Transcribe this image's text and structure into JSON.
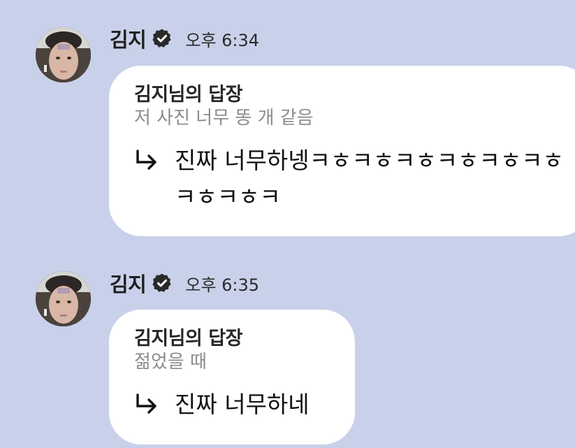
{
  "colors": {
    "background": "#c9d1ea",
    "bubble": "#ffffff",
    "verified_badge": "#2a2a2a",
    "quoted_text": "#8c8c8c"
  },
  "messages": [
    {
      "sender": "김지",
      "verified_icon": "verified-badge-icon",
      "time": "오후 6:34",
      "reply_label": "김지님의 답장",
      "quoted_text": "저 사진 너무 똥 개 같음",
      "reply_icon": "reply-arrow-icon",
      "body": "진짜 너무하넹ㅋㅎㅋㅎㅋㅎㅋㅎㅋㅎㅋㅎㅋㅎㅋㅎㅋ"
    },
    {
      "sender": "김지",
      "verified_icon": "verified-badge-icon",
      "time": "오후 6:35",
      "reply_label": "김지님의 답장",
      "quoted_text": "젊었을 때",
      "reply_icon": "reply-arrow-icon",
      "body": "진짜 너무하네"
    }
  ]
}
